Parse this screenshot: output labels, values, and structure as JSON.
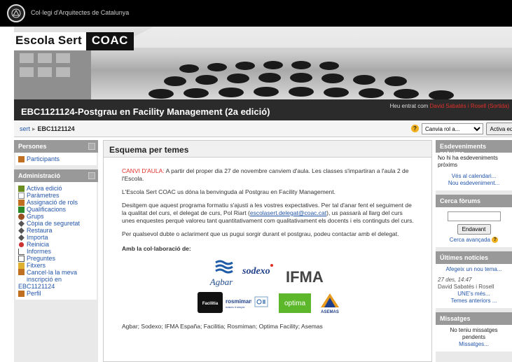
{
  "top": {
    "org_name": "Col·legi d'Arquitectes de Catalunya"
  },
  "banner": {
    "title_part1": "Escola Sert",
    "title_part2": "COAC"
  },
  "course": {
    "title": "EBC1121124-Postgrau en Facility Management (2a edició)",
    "login_prefix": "Heu entrat com",
    "login_user": "David Sabatés i Rosell",
    "login_suffix": "(Sortida)"
  },
  "nav": {
    "crumb_home": "sert",
    "crumb_sep": "▸",
    "crumb_current": "EBC1121124",
    "role_select_value": "Canvia rol a...",
    "edit_button": "Activa edició"
  },
  "left": {
    "people_title": "Persones",
    "participants": "Participants",
    "admin_title": "Administració",
    "admin_items": [
      {
        "label": "Activa edició",
        "icon": "pencil-icon",
        "color": "#6b8e23"
      },
      {
        "label": "Paràmetres",
        "icon": "document-icon",
        "color": "#888888"
      },
      {
        "label": "Assignació de rols",
        "icon": "people-icon",
        "color": "#c07020"
      },
      {
        "label": "Qualificacions",
        "icon": "grades-icon",
        "color": "#2a8a2a"
      },
      {
        "label": "Grups",
        "icon": "groups-icon",
        "color": "#9a5020"
      },
      {
        "label": "Còpia de seguretat",
        "icon": "backup-icon",
        "color": "#555555"
      },
      {
        "label": "Restaura",
        "icon": "restore-icon",
        "color": "#555555"
      },
      {
        "label": "Importa",
        "icon": "import-icon",
        "color": "#555555"
      },
      {
        "label": "Reinicia",
        "icon": "reset-icon",
        "color": "#cc3333"
      },
      {
        "label": "Informes",
        "icon": "chart-icon",
        "color": "#555555"
      },
      {
        "label": "Preguntes",
        "icon": "questions-icon",
        "color": "#555555"
      },
      {
        "label": "Fitxers",
        "icon": "folder-icon",
        "color": "#e0b030"
      }
    ],
    "unenrol_line1": "Cancel·la la meva",
    "unenrol_line2": "inscripció en",
    "unenrol_line3": "EBC1121124",
    "profile": "Perfil"
  },
  "main": {
    "heading": "Esquema per temes",
    "notice_label": "CANVI D'AULA:",
    "notice_text": " A partir del proper dia 27 de novembre canviem d'aula. Les classes s'impartiran a l'aula 2 de l'Escola.",
    "p_welcome": "L'Escola Sert COAC us dóna la benvinguda al Postgrau en Facility Management.",
    "p_desire_1": "Desitgem que aquest programa formatiu s'ajusti a les vostres expectatives. Per tal d'anar fent el seguiment de la qualitat del curs, el delegat de curs, Pol Riart (",
    "p_desire_email": "escolasert.delegat@coac.cat",
    "p_desire_2": "), us passarà al llarg del curs unes enquestes perquè valoreu tant quantitativament com qualitativament els docents i els continguts del curs.",
    "p_doubts": "Per qualsevol dubte o aclariment que us pugui sorgir durant el postgrau, podeu contactar amb el delegat.",
    "collab_title": "Amb la col·laboració de:",
    "logos": {
      "agbar": "Agbar",
      "sodexo": "sodexo",
      "ifma": "IFMA",
      "facilitia": "Facilitia",
      "rosmiman": "rosmiman",
      "rosmiman_tag": "makes it simple",
      "optima": "optima",
      "asemas": "ASEMAS"
    },
    "sponsors_line": "Agbar; Sodexo; IFMA España; Facilitia; Rosmiman; Optima Facility; Asemas"
  },
  "right": {
    "events_title": "Esdeveniments pròxims",
    "events_none": "No hi ha esdeveniments pròxims",
    "events_calendar": "Vés al calendari...",
    "events_new": "Nou esdeveniment...",
    "forum_title": "Cerca fòrums",
    "forum_button": "Endavant",
    "forum_advanced": "Cerca avançada",
    "news_title": "Últimes notícies",
    "news_add": "Afegeix un nou tema...",
    "news_date": "27 des, 14:47",
    "news_author": "David Sabatés i Rosell",
    "news_more": "UNE's més...",
    "news_older": "Temes anteriors ...",
    "msg_title": "Missatges",
    "msg_none": "No teniu missatges pendents",
    "msg_link": "Missatges..."
  },
  "colors": {
    "accent_red": "#e0302a",
    "link_blue": "#2255aa",
    "block_header": "#999999"
  }
}
